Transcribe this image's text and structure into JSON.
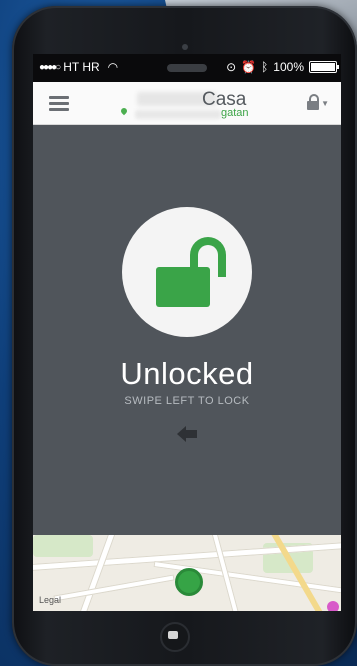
{
  "status_bar": {
    "carrier": "HT HR",
    "signal_dots": "●●●●○",
    "battery_percent": "100%"
  },
  "header": {
    "title": "Casa",
    "subtitle_fragment": "gatan"
  },
  "lock": {
    "state": "Unlocked",
    "hint": "SWIPE LEFT TO LOCK"
  },
  "map": {
    "legal": "Legal"
  },
  "colors": {
    "accent_green": "#3aa448",
    "screen_bg": "#50555b",
    "header_bg": "#fafafa"
  },
  "icons": {
    "menu": "hamburger-menu-icon",
    "lock_dropdown": "padlock-icon",
    "big_lock": "unlocked-padlock-icon",
    "swipe_arrow": "left-arrow-icon",
    "pin": "location-pin-icon"
  }
}
